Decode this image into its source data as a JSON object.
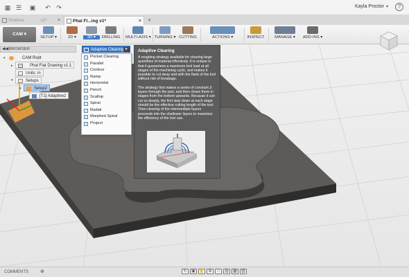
{
  "quick_access": {
    "icons": [
      "app-menu-icon",
      "data-panel-icon",
      "save-icon",
      "undo-icon",
      "redo-icon"
    ]
  },
  "tabs": [
    {
      "label": "Shallow",
      "version": "v2*",
      "active": false
    },
    {
      "label": "Phal Fl...ing v1*",
      "active": true
    }
  ],
  "user": {
    "name": "Kayla Proctor"
  },
  "ribbon": {
    "workspace": "CAM ▾",
    "groups": [
      {
        "label": "SETUP ▾",
        "icon": "setup-icon"
      },
      {
        "label": "2D ▾",
        "icon": "2d-icon"
      },
      {
        "label": "3D ▾",
        "icon": "3d-icon",
        "selected": true
      },
      {
        "label": "DRILLING",
        "icon": "drilling-icon"
      },
      {
        "label": "MULTI-AXIS ▾",
        "icon": "multi-axis-icon"
      },
      {
        "label": "TURNING ▾",
        "icon": "turning-icon"
      },
      {
        "label": "CUTTING",
        "icon": "cutting-icon"
      },
      {
        "label": "ACTIONS ▾",
        "icon": "actions-icon"
      },
      {
        "label": "INSPECT",
        "icon": "inspect-icon"
      },
      {
        "label": "MANAGE ▾",
        "icon": "manage-icon"
      },
      {
        "label": "ADD-INS ▾",
        "icon": "add-ins-icon"
      }
    ]
  },
  "browser": {
    "title": "BROWSER",
    "nodes": {
      "cam_root": "CAM Root",
      "document": "Phal Flat Drawing v1:1",
      "units": "Units: in",
      "setups": "Setups",
      "setup2": "Setup2",
      "adaptive": "[T1] Adaptive2"
    }
  },
  "dropdown": {
    "header": "Adaptive Clearing",
    "items": [
      "Pocket Clearing",
      "Parallel",
      "Contour",
      "Ramp",
      "Horizontal",
      "Pencil",
      "Scallop",
      "Spiral",
      "Radial",
      "Morphed Spiral",
      "Project"
    ]
  },
  "tooltip": {
    "title": "Adaptive Clearing",
    "para1": "A roughing strategy available for clearing large quantities of material effectively. It is unique in that it guarantees a maximum tool load at all stages of the machining cycle, and makes it possible to cut deep and with the flank of the tool without risk of breakage.",
    "para2": "The strategy first makes a series of constant Z-layers through the part, and then clears them in stages from the bottom upwards. Because it can cut so deeply, the first step down at each stage should be the effective cutting length of the tool. Then clearing of the intermediate layers proceeds into the shallower layers to maximize the efficiency of the tool use."
  },
  "comments": {
    "label": "COMMENTS"
  },
  "colors": {
    "accent": "#3b79c9",
    "tooltip_bg": "#5d5d5d",
    "part_top": "#5e5a57",
    "setup_orange": "#f2a13a"
  }
}
